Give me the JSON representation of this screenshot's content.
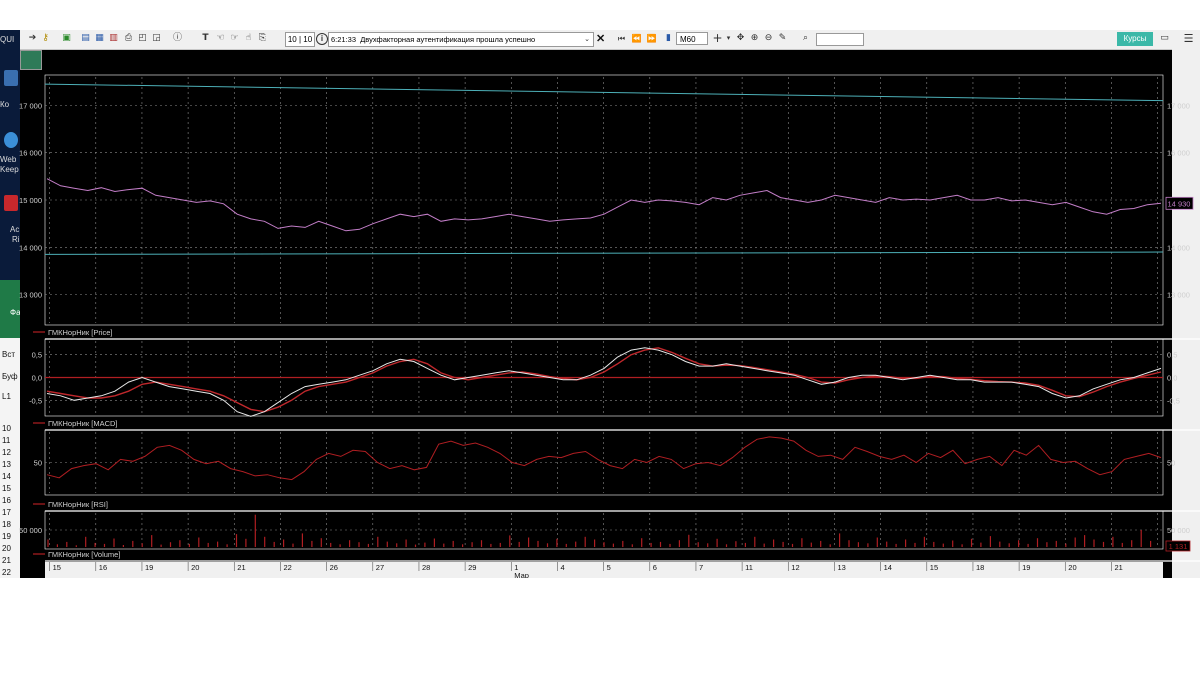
{
  "toolbar": {
    "trade_counter": "10 | 10",
    "message_time": "6:21:33",
    "message_text": "Двухфакторная аутентификация прошла успешно",
    "timeframe": "M60",
    "search_value": "",
    "quotes_button": "Курсы"
  },
  "desktop": {
    "labels": [
      "QUI",
      "Ко",
      "Web",
      "Keep",
      "Ac",
      "Ri",
      "Фа",
      "Вст",
      "Буф",
      "L1"
    ],
    "row_numbers": [
      "10",
      "11",
      "12",
      "13",
      "14",
      "15",
      "16",
      "17",
      "18",
      "19",
      "20",
      "21",
      "22"
    ]
  },
  "colors": {
    "background": "#000000",
    "grid": "#8a8a8a",
    "price_line": "#c37ec8",
    "band_line": "#4db0b8",
    "macd_line": "#e8e8e8",
    "signal_line": "#c0282c",
    "indicator_red": "#b01e22",
    "panel_border": "#ffffff",
    "quotes_button": "#3bb8a8"
  },
  "icons": [
    "arrow-icon",
    "key-icon",
    "new-window-icon",
    "table-icon",
    "chart-icon",
    "order-icon",
    "print-icon",
    "zoom-icon",
    "find-icon",
    "info-icon",
    "text-icon",
    "hand-icon",
    "copy-icon",
    "skip-back-icon",
    "rewind-icon",
    "forward-icon",
    "bar-chart-icon",
    "plus-icon",
    "move-icon",
    "zoom-in-icon",
    "zoom-out-icon",
    "pencil-icon",
    "search-icon",
    "message-icon",
    "menu-icon"
  ],
  "chart_data": [
    {
      "type": "line",
      "legend": "ГМКНорНик [Price]",
      "ylim": [
        12400,
        17600
      ],
      "y_ticks": [
        13000,
        14000,
        15000,
        16000,
        17000
      ],
      "y_tick_labels": [
        "13 000",
        "14 000",
        "15 000",
        "16 000",
        "17 000"
      ],
      "last_value": 14930,
      "last_value_label": "14 930",
      "series": [
        {
          "values": [
            15450,
            15300,
            15250,
            15200,
            15260,
            15180,
            15220,
            15250,
            15100,
            15050,
            15000,
            14950,
            14980,
            14920,
            14700,
            14600,
            14550,
            14400,
            14450,
            14420,
            14550,
            14450,
            14350,
            14380,
            14500,
            14600,
            14700,
            14650,
            14700,
            14550,
            14600,
            14580,
            14600,
            14650,
            14700,
            14650,
            14600,
            14550,
            14580,
            14600,
            14620,
            14700,
            14850,
            15000,
            14950,
            15000,
            14980,
            14950,
            14900,
            15050,
            15000,
            15100,
            15150,
            15200,
            15050,
            15000,
            14950,
            15000,
            15100,
            15050,
            15000,
            14950,
            15050,
            15000,
            15020,
            15000,
            15050,
            15100,
            15000,
            15000,
            15050,
            14980,
            15000,
            14950,
            14900,
            14950,
            14850,
            14750,
            14700,
            14800,
            14820,
            14900,
            14930
          ]
        }
      ]
    },
    {
      "type": "line",
      "legend": "ГМКНорНик [MACD]",
      "ylim": [
        -0.8,
        0.8
      ],
      "y_ticks": [
        -0.5,
        0,
        0.5
      ],
      "y_tick_labels": [
        "-0,5",
        "0,0",
        "0,5"
      ],
      "series": [
        {
          "values": [
            -0.35,
            -0.4,
            -0.5,
            -0.45,
            -0.4,
            -0.3,
            -0.1,
            0.0,
            -0.1,
            -0.2,
            -0.25,
            -0.3,
            -0.35,
            -0.5,
            -0.75,
            -0.85,
            -0.75,
            -0.55,
            -0.35,
            -0.2,
            -0.15,
            -0.1,
            -0.05,
            0.05,
            0.15,
            0.3,
            0.4,
            0.35,
            0.2,
            0.05,
            -0.05,
            0.0,
            0.05,
            0.1,
            0.15,
            0.1,
            0.05,
            0.0,
            -0.05,
            -0.05,
            0.05,
            0.2,
            0.45,
            0.6,
            0.65,
            0.6,
            0.5,
            0.35,
            0.25,
            0.25,
            0.3,
            0.25,
            0.2,
            0.15,
            0.1,
            0.05,
            -0.05,
            -0.15,
            -0.1,
            0.0,
            0.05,
            0.05,
            0.0,
            -0.05,
            0.0,
            0.05,
            0.0,
            -0.05,
            -0.05,
            -0.1,
            -0.1,
            -0.1,
            -0.15,
            -0.2,
            -0.35,
            -0.45,
            -0.4,
            -0.25,
            -0.15,
            -0.05,
            0.0,
            0.1,
            0.2
          ]
        },
        {
          "values": [
            -0.3,
            -0.35,
            -0.4,
            -0.45,
            -0.45,
            -0.4,
            -0.3,
            -0.15,
            -0.1,
            -0.15,
            -0.2,
            -0.25,
            -0.3,
            -0.4,
            -0.55,
            -0.7,
            -0.75,
            -0.65,
            -0.5,
            -0.3,
            -0.2,
            -0.15,
            -0.1,
            0.0,
            0.1,
            0.25,
            0.35,
            0.4,
            0.3,
            0.1,
            0.0,
            -0.05,
            0.0,
            0.05,
            0.1,
            0.12,
            0.08,
            0.02,
            -0.02,
            -0.05,
            0.0,
            0.12,
            0.3,
            0.5,
            0.6,
            0.65,
            0.55,
            0.42,
            0.3,
            0.25,
            0.27,
            0.26,
            0.22,
            0.17,
            0.12,
            0.07,
            0.0,
            -0.1,
            -0.12,
            -0.05,
            0.0,
            0.03,
            0.02,
            -0.02,
            -0.02,
            0.02,
            0.02,
            -0.02,
            -0.04,
            -0.07,
            -0.09,
            -0.1,
            -0.12,
            -0.17,
            -0.28,
            -0.4,
            -0.42,
            -0.32,
            -0.2,
            -0.1,
            -0.02,
            0.05,
            0.12
          ]
        }
      ]
    },
    {
      "type": "line",
      "legend": "ГМКНорНик [RSI]",
      "y_ticks": [
        50
      ],
      "y_tick_labels": [
        "50"
      ],
      "ylim": [
        0,
        100
      ],
      "series": [
        {
          "values": [
            30,
            25,
            40,
            45,
            48,
            38,
            55,
            52,
            60,
            75,
            78,
            70,
            55,
            48,
            52,
            40,
            35,
            28,
            30,
            25,
            22,
            35,
            55,
            65,
            60,
            70,
            68,
            50,
            40,
            45,
            38,
            42,
            80,
            85,
            78,
            82,
            75,
            65,
            50,
            45,
            55,
            60,
            58,
            65,
            68,
            55,
            45,
            40,
            55,
            50,
            60,
            55,
            40,
            48,
            50,
            45,
            58,
            75,
            88,
            92,
            90,
            85,
            70,
            60,
            62,
            55,
            75,
            68,
            60,
            55,
            62,
            50,
            65,
            58,
            70,
            48,
            55,
            60,
            45,
            70,
            62,
            78,
            55,
            50,
            52,
            40,
            30,
            35,
            55,
            60,
            65,
            58
          ]
        }
      ]
    },
    {
      "type": "bar",
      "legend": "ГМКНорНик [Volume]",
      "y_ticks": [
        50000
      ],
      "y_tick_labels": [
        "50 000"
      ],
      "ylim": [
        0,
        100000
      ],
      "value_badge": "1 131",
      "values": [
        22000,
        8000,
        15000,
        5000,
        30000,
        12000,
        9000,
        25000,
        6000,
        18000,
        11000,
        35000,
        7000,
        14000,
        20000,
        9000,
        28000,
        12000,
        16000,
        8000,
        38000,
        24000,
        95000,
        30000,
        15000,
        22000,
        10000,
        40000,
        18000,
        26000,
        12000,
        8000,
        20000,
        14000,
        9000,
        30000,
        16000,
        11000,
        22000,
        7000,
        13000,
        25000,
        10000,
        18000,
        8000,
        14000,
        20000,
        9000,
        12000,
        34000,
        15000,
        28000,
        18000,
        11000,
        24000,
        9000,
        16000,
        30000,
        22000,
        14000,
        10000,
        18000,
        8000,
        26000,
        12000,
        15000,
        9000,
        20000,
        36000,
        14000,
        11000,
        24000,
        8000,
        17000,
        12000,
        30000,
        10000,
        22000,
        15000,
        9000,
        26000,
        13000,
        18000,
        8000,
        40000,
        20000,
        14000,
        11000,
        28000,
        16000,
        9000,
        22000,
        12000,
        30000,
        15000,
        10000,
        19000,
        8000,
        24000,
        13000,
        32000,
        16000,
        11000,
        20000,
        9000,
        26000,
        14000,
        18000,
        10000,
        28000,
        35000,
        22000,
        15000,
        30000,
        12000,
        20000,
        50000,
        18000
      ]
    }
  ],
  "x_axis": {
    "dates": [
      "15",
      "16",
      "19",
      "20",
      "21",
      "22",
      "26",
      "27",
      "28",
      "29",
      "1",
      "4",
      "5",
      "6",
      "7",
      "11",
      "12",
      "13",
      "14",
      "15",
      "18",
      "19",
      "20",
      "21"
    ],
    "month_label": "Мар"
  }
}
